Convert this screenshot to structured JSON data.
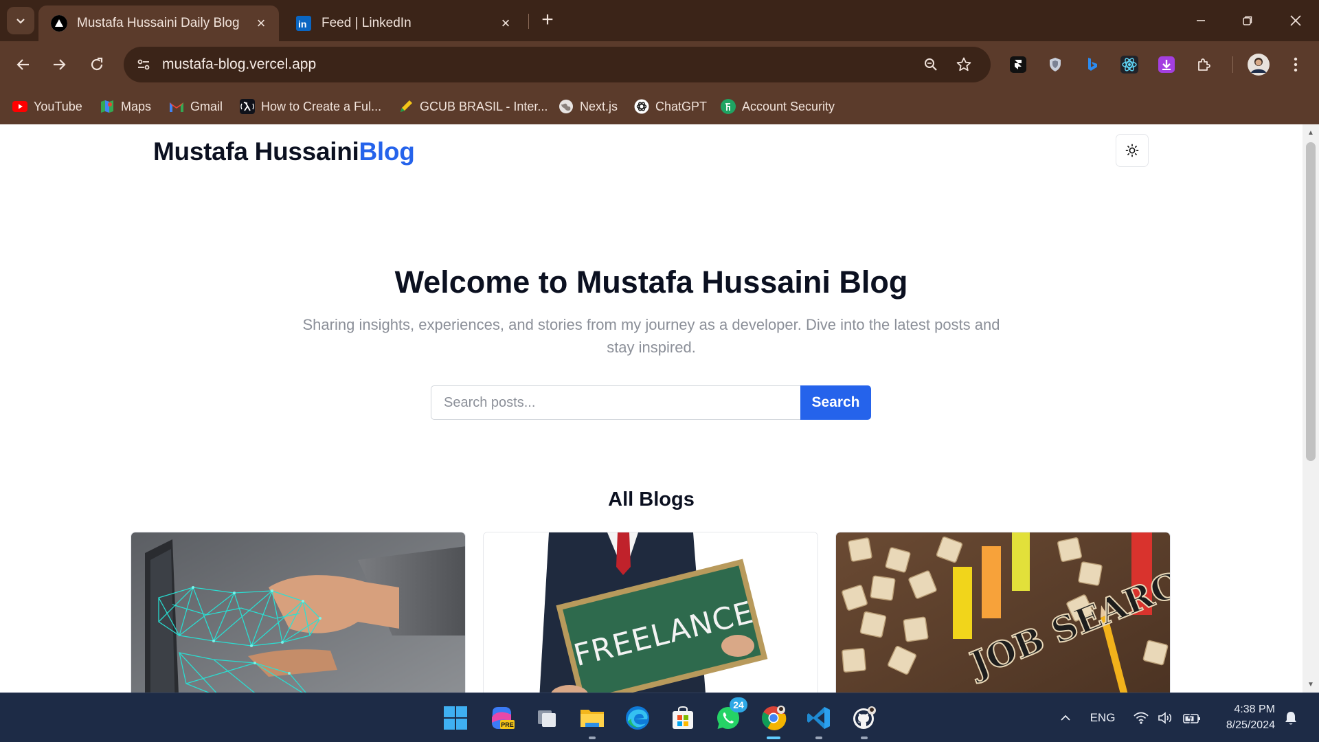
{
  "browser": {
    "tabs": [
      {
        "title": "Mustafa Hussaini Daily Blog",
        "favicon": "triangle-icon",
        "active": true
      },
      {
        "title": "Feed | LinkedIn",
        "favicon": "linkedin-icon",
        "active": false
      }
    ],
    "url": "mustafa-blog.vercel.app",
    "bookmarks": [
      {
        "label": "YouTube",
        "icon": "youtube-icon"
      },
      {
        "label": "Maps",
        "icon": "maps-icon"
      },
      {
        "label": "Gmail",
        "icon": "gmail-icon"
      },
      {
        "label": "How to Create a Ful...",
        "icon": "lambda-icon"
      },
      {
        "label": "GCUB BRASIL - Inter...",
        "icon": "pencil-icon"
      },
      {
        "label": "Next.js",
        "icon": "globe-icon"
      },
      {
        "label": "ChatGPT",
        "icon": "openai-icon"
      },
      {
        "label": "Account Security",
        "icon": "shield-icon"
      }
    ]
  },
  "page": {
    "logo_main": "Mustafa Hussaini",
    "logo_accent": "Blog",
    "hero_title": "Welcome to Mustafa Hussaini Blog",
    "hero_subtitle": "Sharing insights, experiences, and stories from my journey as a developer. Dive into the latest posts and stay inspired.",
    "search_placeholder": "Search posts...",
    "search_button": "Search",
    "section_title": "All Blogs",
    "cards": [
      {
        "image": "ai-handshake-image"
      },
      {
        "image": "freelance-chalkboard-image",
        "image_text": "FREELANCE"
      },
      {
        "image": "job-search-tiles-image",
        "image_text": "JOB SEARCH"
      }
    ]
  },
  "taskbar": {
    "whatsapp_badge": "24",
    "copilot_badge": "PRE",
    "language": "ENG",
    "time": "4:38 PM",
    "date": "8/25/2024"
  },
  "colors": {
    "accent": "#2563eb",
    "chrome_frame": "#3b2418",
    "chrome_toolbar": "#5b3b2b",
    "taskbar": "#1d2b46"
  }
}
